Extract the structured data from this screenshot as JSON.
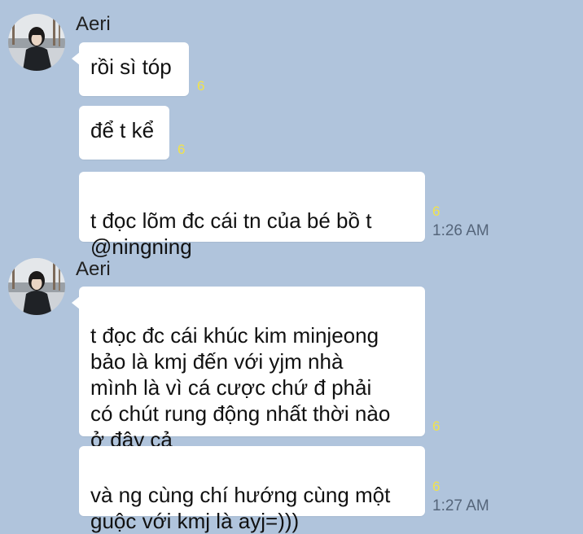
{
  "messages": [
    {
      "sender": "Aeri",
      "bubbles": [
        {
          "text": "rồi sì tóp",
          "read_count": "6"
        },
        {
          "text": "để t kể",
          "read_count": "6"
        },
        {
          "text": "t đọc lõm đc cái tn của bé bồ t\n@ningning",
          "read_count": "6",
          "time": "1:26 AM"
        }
      ]
    },
    {
      "sender": "Aeri",
      "bubbles": [
        {
          "text": "t đọc đc cái khúc kim minjeong\nbảo là kmj đến với yjm nhà\nmình là vì cá cược chứ đ phải\ncó chút rung động nhất thời nào\nở đây cả",
          "read_count": "6"
        },
        {
          "text": "và ng cùng chí hướng cùng một\nguộc với kmj là ayj=)))",
          "read_count": "6",
          "time": "1:27 AM"
        }
      ]
    }
  ]
}
